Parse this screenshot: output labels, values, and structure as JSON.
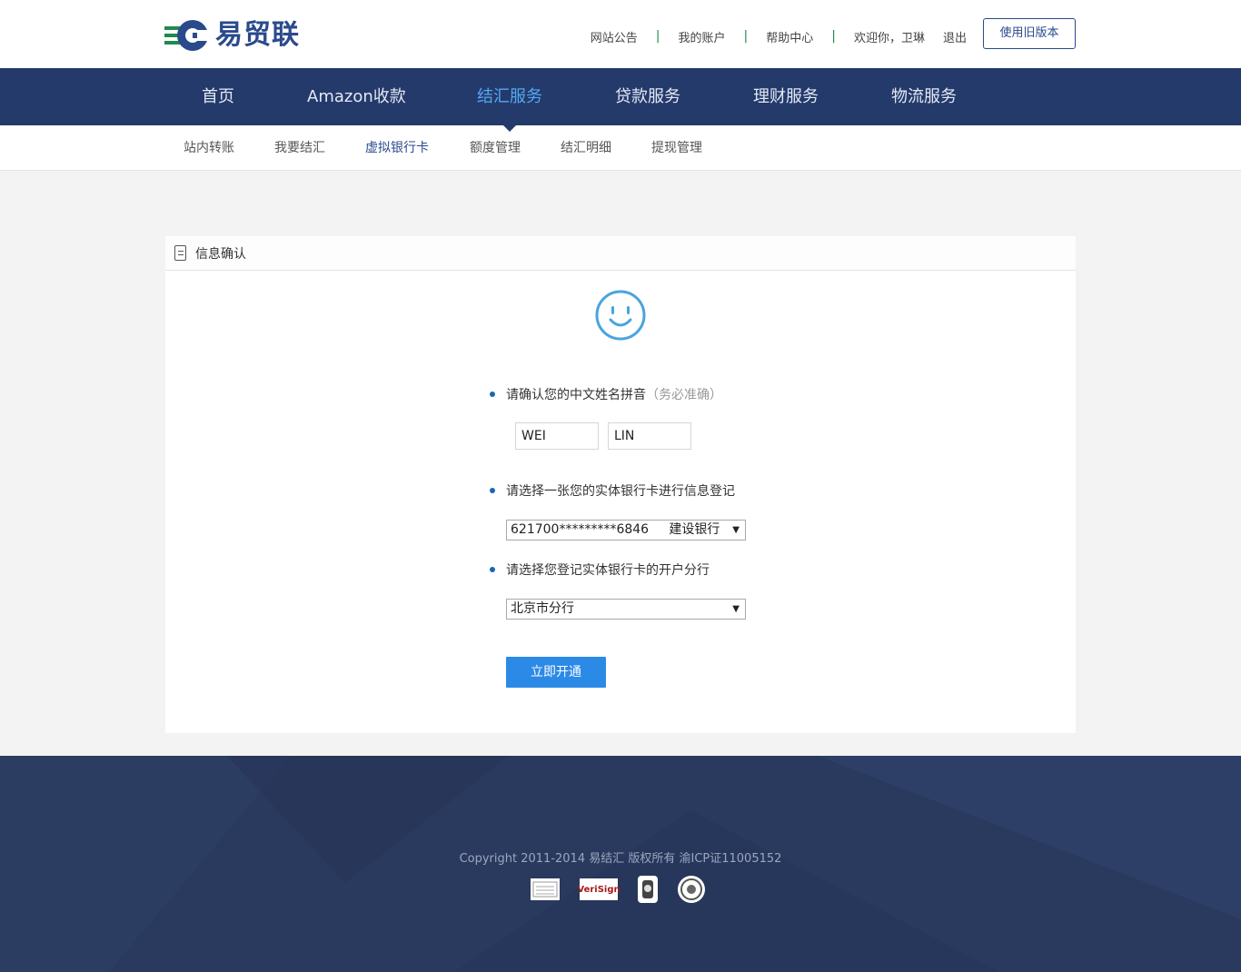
{
  "brand": {
    "name": "易贸联",
    "colors": {
      "primary": "#233a6b",
      "accent": "#55a8ef",
      "button": "#2b8ae6",
      "logo_green": "#1f8b4c"
    }
  },
  "topnav": {
    "announcements": "网站公告",
    "my_account": "我的账户",
    "help_center": "帮助中心",
    "welcome": "欢迎你，卫琳",
    "logout": "退出",
    "separator": "|",
    "old_version": "使用旧版本"
  },
  "mainnav": {
    "items": [
      "首页",
      "Amazon收款",
      "结汇服务",
      "贷款服务",
      "理财服务",
      "物流服务"
    ],
    "active": "结汇服务"
  },
  "subnav": {
    "items": [
      "站内转账",
      "我要结汇",
      "虚拟银行卡",
      "额度管理",
      "结汇明细",
      "提现管理"
    ],
    "active": "虚拟银行卡"
  },
  "panel": {
    "title": "信息确认",
    "icon": "smile-icon",
    "q1": "请确认您的中文姓名拼音",
    "q1_hint": "（务必准确）",
    "surname": "WEI",
    "given_name": "LIN",
    "q2": "请选择一张您的实体银行卡进行信息登记",
    "card_select": "621700*********6846     建设银行",
    "q3": "请选择您登记实体银行卡的开户分行",
    "branch_select": "北京市分行",
    "submit": "立即开通"
  },
  "footer": {
    "copyright": "Copyright 2011-2014 易结汇 版权所有 渝ICP证11005152",
    "badges": [
      "verisign",
      "trust-seal",
      "police-badge"
    ],
    "verisign_text": "VeriSign"
  }
}
